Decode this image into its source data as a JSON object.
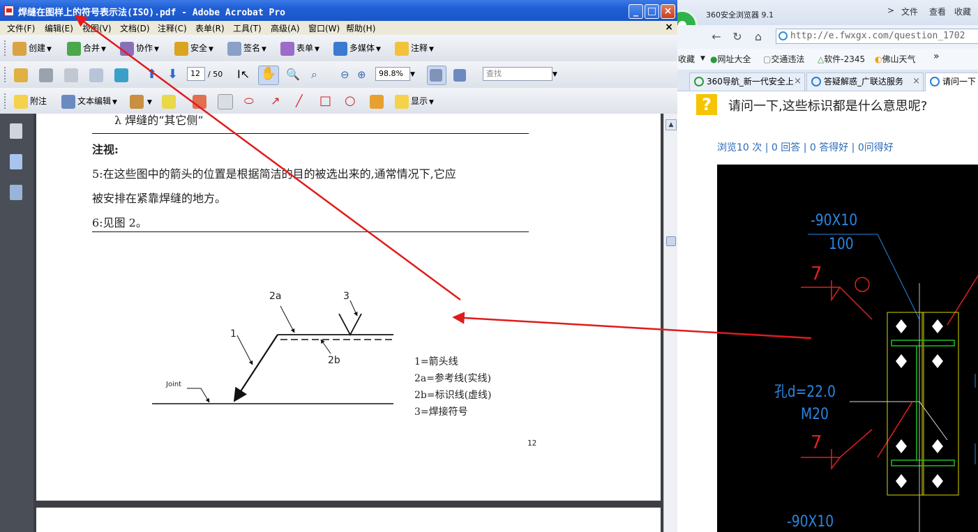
{
  "acrobat": {
    "title": "焊缝在图样上的符号表示法(ISO).pdf - Adobe Acrobat Pro",
    "menu": [
      "文件(F)",
      "编辑(E)",
      "视图(V)",
      "文档(D)",
      "注释(C)",
      "表单(R)",
      "工具(T)",
      "高级(A)",
      "窗口(W)",
      "帮助(H)"
    ],
    "toolbar1": {
      "create": "创建",
      "combine": "合并",
      "collaborate": "协作",
      "secure": "安全",
      "sign": "签名",
      "forms": "表单",
      "multimedia": "多媒体",
      "comment": "注释"
    },
    "toolbar2": {
      "page_current": "12",
      "page_total": "/ 50",
      "zoom": "98.8%",
      "find_placeholder": "查找"
    },
    "toolbar3": {
      "sticky_note": "附注",
      "text_edit": "文本编辑",
      "show": "显示"
    },
    "document": {
      "partial_line": "λ  焊缝的“其它侧”",
      "note_heading": "注视:",
      "note5_line1": "5:在这些图中的箭头的位置是根据简洁的目的被选出来的,通常情况下,它应",
      "note5_line2": "被安排在紧靠焊缝的地方。",
      "note6": "6:见图 2。",
      "figure": {
        "label_1": "1",
        "label_2a": "2a",
        "label_2b": "2b",
        "label_3": "3",
        "label_joint": "Joint"
      },
      "legend": [
        "1=箭头线",
        "2a=参考线(实线)",
        "2b=标识线(虚线)",
        "3=焊接符号"
      ],
      "page_number": "12"
    }
  },
  "browser": {
    "title": "360安全浏览器 9.1",
    "menu": [
      "文件",
      "查看",
      "收藏"
    ],
    "menu_chevron": ">",
    "address": "http://e.fwxgx.com/question_1702",
    "favorites_label": "收藏",
    "favorites": [
      "网址大全",
      "交通违法",
      "软件-2345",
      "佛山天气"
    ],
    "favorites_more": "»",
    "tabs": [
      "360导航_新一代安全上",
      "答疑解惑_广联达服务",
      "请问一下"
    ],
    "question": "请问一下,这些标识都是什么意思呢?",
    "stats": "浏览10 次 | 0 回答 | 0 答得好 | 0问得好",
    "cad": {
      "top_label": "-90X10",
      "top_value": "100",
      "mark_7": "7",
      "hole_label": "孔d=22.0",
      "bolt_label": "M20",
      "bottom_label": "-90X10"
    }
  },
  "colors": {
    "annotation_red": "#e01b1b",
    "xp_blue": "#1f5fd6",
    "cad_blue": "#2a86e0",
    "cad_red": "#e02020"
  }
}
